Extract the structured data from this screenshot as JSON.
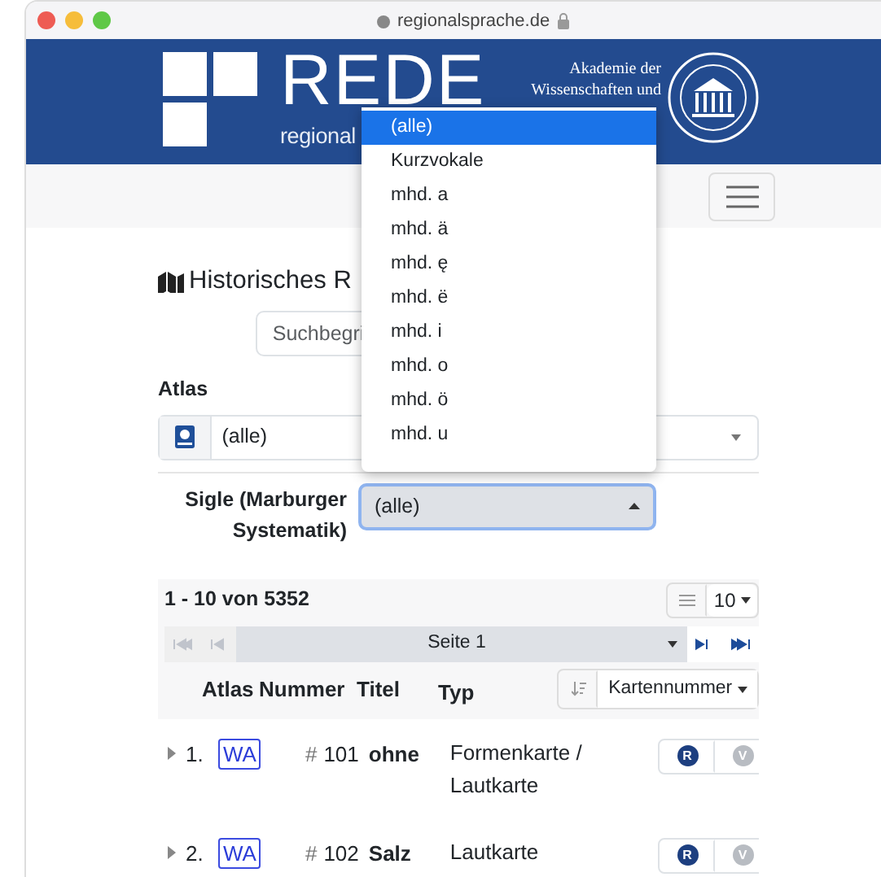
{
  "browser": {
    "url": "regionalsprache.de"
  },
  "header": {
    "logo_text": "REDE",
    "logo_subtext": "regional",
    "academy_lines": [
      "Akademie der",
      "Wissenschaften und"
    ]
  },
  "title": "Historisches R",
  "search": {
    "placeholder": "Suchbegri"
  },
  "atlas": {
    "label": "Atlas",
    "value": "(alle)"
  },
  "sigle": {
    "label": "Sigle (Marburger Systematik)",
    "value": "(alle)",
    "expanded": true,
    "options": [
      {
        "label": "(alle)",
        "selected": true
      },
      {
        "label": "Kurzvokale",
        "selected": false
      },
      {
        "label": "mhd. a",
        "selected": false
      },
      {
        "label": "mhd. ä",
        "selected": false
      },
      {
        "label": "mhd. ę",
        "selected": false
      },
      {
        "label": "mhd. ë",
        "selected": false
      },
      {
        "label": "mhd. i",
        "selected": false
      },
      {
        "label": "mhd. o",
        "selected": false
      },
      {
        "label": "mhd. ö",
        "selected": false
      },
      {
        "label": "mhd. u",
        "selected": false
      }
    ]
  },
  "results": {
    "count": "1 - 10 von 5352",
    "page_size": "10",
    "page": "Seite 1",
    "nav_buttons": [
      {
        "kind": "first",
        "disabled": true
      },
      {
        "kind": "prev",
        "disabled": true
      },
      {
        "kind": "next",
        "disabled": false
      },
      {
        "kind": "last",
        "disabled": false
      }
    ],
    "columns": [
      "Atlas",
      "Nummer",
      "Titel",
      "Typ"
    ],
    "sort": "Kartennummer",
    "rows": [
      {
        "index": "1.",
        "atlas": "WA",
        "hash": "#",
        "number": "101",
        "title": "ohne",
        "type": "Formenkarte / Lautkarte",
        "actions": [
          {
            "label": "R",
            "disabled": false
          },
          {
            "label": "V",
            "disabled": true
          }
        ]
      },
      {
        "index": "2.",
        "atlas": "WA",
        "hash": "#",
        "number": "102",
        "title": "Salz",
        "type": "Lautkarte",
        "actions": [
          {
            "label": "R",
            "disabled": false
          },
          {
            "label": "V",
            "disabled": true
          }
        ]
      }
    ]
  }
}
